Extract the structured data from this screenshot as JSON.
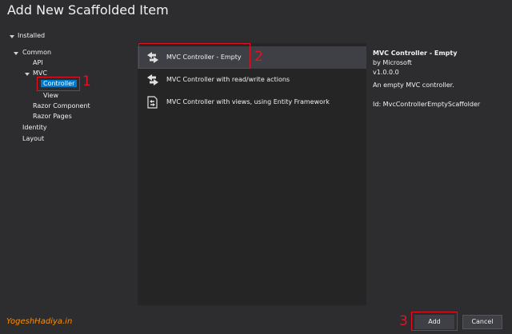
{
  "window": {
    "title": "Add New Scaffolded Item"
  },
  "tree": {
    "installed": "Installed",
    "common": "Common",
    "api": "API",
    "mvc": "MVC",
    "controller": "Controller",
    "view": "View",
    "razor_component": "Razor Component",
    "razor_pages": "Razor Pages",
    "identity": "Identity",
    "layout": "Layout"
  },
  "items": [
    {
      "label": "MVC Controller - Empty",
      "selected": true,
      "icon": "controller-icon"
    },
    {
      "label": "MVC Controller with read/write actions",
      "selected": false,
      "icon": "controller-icon"
    },
    {
      "label": "MVC Controller with views, using Entity Framework",
      "selected": false,
      "icon": "controller-ef-icon"
    }
  ],
  "details": {
    "title": "MVC Controller - Empty",
    "author": "by Microsoft",
    "version": "v1.0.0.0",
    "description": "An empty MVC controller.",
    "id": "Id: MvcControllerEmptyScaffolder"
  },
  "annotations": {
    "one": "1",
    "two": "2",
    "three": "3"
  },
  "brand": "YogeshHadiya.in",
  "buttons": {
    "add": "Add",
    "cancel": "Cancel"
  },
  "colors": {
    "accent": "#007acc",
    "annotation": "#e81123",
    "brand": "#ff8c00"
  }
}
